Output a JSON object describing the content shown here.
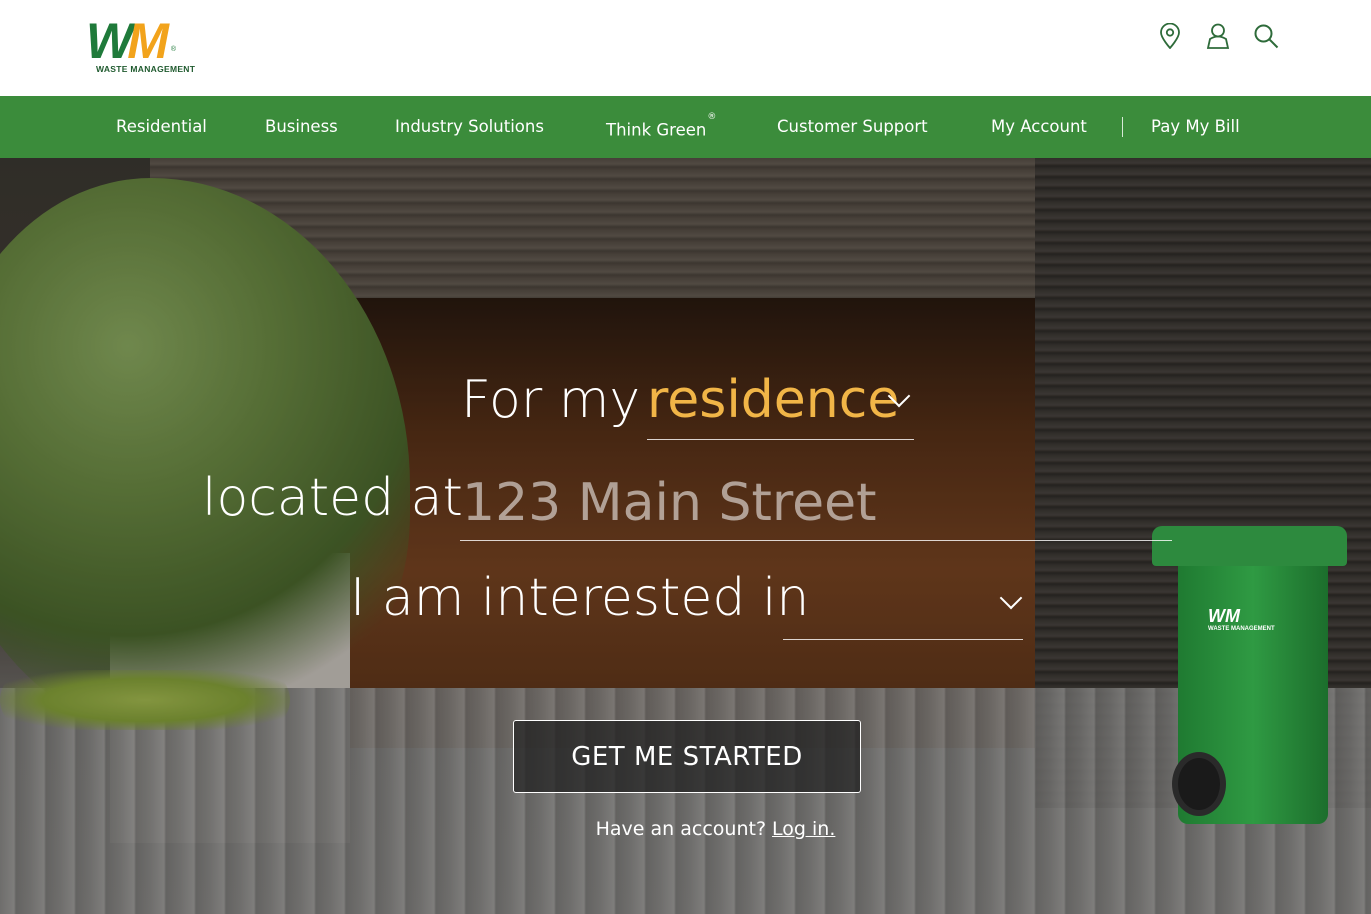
{
  "brand": {
    "logo_w": "W",
    "logo_m": "M",
    "logo_reg": "®",
    "logo_subtitle": "WASTE MANAGEMENT",
    "primary_green": "#3b8c3b",
    "logo_green": "#1f7a3a",
    "logo_gold": "#f2a31b"
  },
  "header": {
    "icons": [
      "location-pin-icon",
      "user-icon",
      "search-icon"
    ]
  },
  "nav": {
    "items": [
      {
        "label": "Residential"
      },
      {
        "label": "Business"
      },
      {
        "label": "Industry Solutions"
      },
      {
        "label": "Think Green",
        "superscript": "®"
      },
      {
        "label": "Customer Support"
      },
      {
        "label": "My Account"
      },
      {
        "label": "Pay My Bill"
      }
    ]
  },
  "form": {
    "line1_prefix": "For my",
    "service_type_value": "residence",
    "line2_prefix": "located at",
    "address_placeholder": "123 Main Street",
    "address_value": "",
    "line3_prefix": "I am interested in",
    "interest_value": "",
    "submit_label": "GET ME STARTED"
  },
  "account": {
    "prompt": "Have an account?",
    "login_link": "Log in."
  },
  "bin": {
    "logo_text": "WM",
    "subtitle": "WASTE MANAGEMENT"
  }
}
